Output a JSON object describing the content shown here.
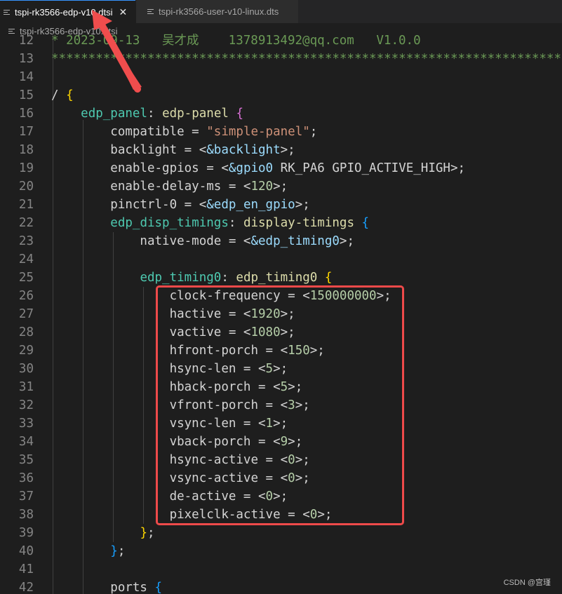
{
  "tabs": [
    {
      "label": "tspi-rk3566-edp-v10.dtsi",
      "close": "✕",
      "icon": "file-lines-icon"
    },
    {
      "label": "tspi-rk3566-user-v10-linux.dts",
      "icon": "file-lines-icon"
    }
  ],
  "breadcrumb": {
    "label": "tspi-rk3566-edp-v10.dtsi"
  },
  "code": {
    "lines": [
      {
        "n": "12",
        "tokens": [
          {
            "t": "* 2023-09-13   吴才成    1378913492@qq.com   V1.0.0",
            "c": "comment"
          }
        ]
      },
      {
        "n": "13",
        "tokens": [
          {
            "t": "****************************************************************************",
            "c": "comment"
          }
        ]
      },
      {
        "n": "14",
        "tokens": []
      },
      {
        "n": "15",
        "tokens": [
          {
            "t": "/ ",
            "c": "plain"
          },
          {
            "t": "{",
            "c": "brace1"
          }
        ]
      },
      {
        "n": "16",
        "tokens": [
          {
            "t": "    ",
            "c": "plain"
          },
          {
            "t": "edp_panel",
            "c": "node"
          },
          {
            "t": ": ",
            "c": "plain"
          },
          {
            "t": "edp-panel",
            "c": "func"
          },
          {
            "t": " ",
            "c": "plain"
          },
          {
            "t": "{",
            "c": "brace2"
          }
        ]
      },
      {
        "n": "17",
        "tokens": [
          {
            "t": "        compatible = ",
            "c": "plain"
          },
          {
            "t": "\"simple-panel\"",
            "c": "str"
          },
          {
            "t": ";",
            "c": "plain"
          }
        ]
      },
      {
        "n": "18",
        "tokens": [
          {
            "t": "        backlight = <",
            "c": "plain"
          },
          {
            "t": "&backlight",
            "c": "var"
          },
          {
            "t": ">;",
            "c": "plain"
          }
        ]
      },
      {
        "n": "19",
        "tokens": [
          {
            "t": "        enable-gpios = <",
            "c": "plain"
          },
          {
            "t": "&gpio0",
            "c": "var"
          },
          {
            "t": " RK_PA6 GPIO_ACTIVE_HIGH>;",
            "c": "plain"
          }
        ]
      },
      {
        "n": "20",
        "tokens": [
          {
            "t": "        enable-delay-ms = <",
            "c": "plain"
          },
          {
            "t": "120",
            "c": "num"
          },
          {
            "t": ">;",
            "c": "plain"
          }
        ]
      },
      {
        "n": "21",
        "tokens": [
          {
            "t": "        pinctrl-0 = <",
            "c": "plain"
          },
          {
            "t": "&edp_en_gpio",
            "c": "var"
          },
          {
            "t": ">;",
            "c": "plain"
          }
        ]
      },
      {
        "n": "22",
        "tokens": [
          {
            "t": "        ",
            "c": "plain"
          },
          {
            "t": "edp_disp_timings",
            "c": "node"
          },
          {
            "t": ": ",
            "c": "plain"
          },
          {
            "t": "display-timings",
            "c": "func"
          },
          {
            "t": " ",
            "c": "plain"
          },
          {
            "t": "{",
            "c": "brace3"
          }
        ]
      },
      {
        "n": "23",
        "tokens": [
          {
            "t": "            native-mode = <",
            "c": "plain"
          },
          {
            "t": "&edp_timing0",
            "c": "var"
          },
          {
            "t": ">;",
            "c": "plain"
          }
        ]
      },
      {
        "n": "24",
        "tokens": []
      },
      {
        "n": "25",
        "tokens": [
          {
            "t": "            ",
            "c": "plain"
          },
          {
            "t": "edp_timing0",
            "c": "node"
          },
          {
            "t": ": ",
            "c": "plain"
          },
          {
            "t": "edp_timing0",
            "c": "func"
          },
          {
            "t": " ",
            "c": "plain"
          },
          {
            "t": "{",
            "c": "brace1"
          }
        ]
      },
      {
        "n": "26",
        "tokens": [
          {
            "t": "                clock-frequency = <",
            "c": "plain"
          },
          {
            "t": "150000000",
            "c": "num"
          },
          {
            "t": ">;",
            "c": "plain"
          }
        ]
      },
      {
        "n": "27",
        "tokens": [
          {
            "t": "                hactive = <",
            "c": "plain"
          },
          {
            "t": "1920",
            "c": "num"
          },
          {
            "t": ">;",
            "c": "plain"
          }
        ]
      },
      {
        "n": "28",
        "tokens": [
          {
            "t": "                vactive = <",
            "c": "plain"
          },
          {
            "t": "1080",
            "c": "num"
          },
          {
            "t": ">;",
            "c": "plain"
          }
        ]
      },
      {
        "n": "29",
        "tokens": [
          {
            "t": "                hfront-porch = <",
            "c": "plain"
          },
          {
            "t": "150",
            "c": "num"
          },
          {
            "t": ">;",
            "c": "plain"
          }
        ]
      },
      {
        "n": "30",
        "tokens": [
          {
            "t": "                hsync-len = <",
            "c": "plain"
          },
          {
            "t": "5",
            "c": "num"
          },
          {
            "t": ">;",
            "c": "plain"
          }
        ]
      },
      {
        "n": "31",
        "tokens": [
          {
            "t": "                hback-porch = <",
            "c": "plain"
          },
          {
            "t": "5",
            "c": "num"
          },
          {
            "t": ">;",
            "c": "plain"
          }
        ]
      },
      {
        "n": "32",
        "tokens": [
          {
            "t": "                vfront-porch = <",
            "c": "plain"
          },
          {
            "t": "3",
            "c": "num"
          },
          {
            "t": ">;",
            "c": "plain"
          }
        ]
      },
      {
        "n": "33",
        "tokens": [
          {
            "t": "                vsync-len = <",
            "c": "plain"
          },
          {
            "t": "1",
            "c": "num"
          },
          {
            "t": ">;",
            "c": "plain"
          }
        ]
      },
      {
        "n": "34",
        "tokens": [
          {
            "t": "                vback-porch = <",
            "c": "plain"
          },
          {
            "t": "9",
            "c": "num"
          },
          {
            "t": ">;",
            "c": "plain"
          }
        ]
      },
      {
        "n": "35",
        "tokens": [
          {
            "t": "                hsync-active = <",
            "c": "plain"
          },
          {
            "t": "0",
            "c": "num"
          },
          {
            "t": ">;",
            "c": "plain"
          }
        ]
      },
      {
        "n": "36",
        "tokens": [
          {
            "t": "                vsync-active = <",
            "c": "plain"
          },
          {
            "t": "0",
            "c": "num"
          },
          {
            "t": ">;",
            "c": "plain"
          }
        ]
      },
      {
        "n": "37",
        "tokens": [
          {
            "t": "                de-active = <",
            "c": "plain"
          },
          {
            "t": "0",
            "c": "num"
          },
          {
            "t": ">;",
            "c": "plain"
          }
        ]
      },
      {
        "n": "38",
        "tokens": [
          {
            "t": "                pixelclk-active = <",
            "c": "plain"
          },
          {
            "t": "0",
            "c": "num"
          },
          {
            "t": ">;",
            "c": "plain"
          }
        ]
      },
      {
        "n": "39",
        "tokens": [
          {
            "t": "            ",
            "c": "plain"
          },
          {
            "t": "}",
            "c": "brace1"
          },
          {
            "t": ";",
            "c": "plain"
          }
        ]
      },
      {
        "n": "40",
        "tokens": [
          {
            "t": "        ",
            "c": "plain"
          },
          {
            "t": "}",
            "c": "brace3"
          },
          {
            "t": ";",
            "c": "plain"
          }
        ]
      },
      {
        "n": "41",
        "tokens": []
      },
      {
        "n": "42",
        "tokens": [
          {
            "t": "        ports ",
            "c": "plain"
          },
          {
            "t": "{",
            "c": "brace3"
          }
        ]
      }
    ]
  },
  "annotation": {
    "box_color": "#ee4a4a",
    "arrow_color": "#f04d4d"
  },
  "watermark": {
    "text": "CSDN @宫瑾"
  },
  "colors": {
    "accent": "#3794ff",
    "background": "#1e1e1e"
  }
}
